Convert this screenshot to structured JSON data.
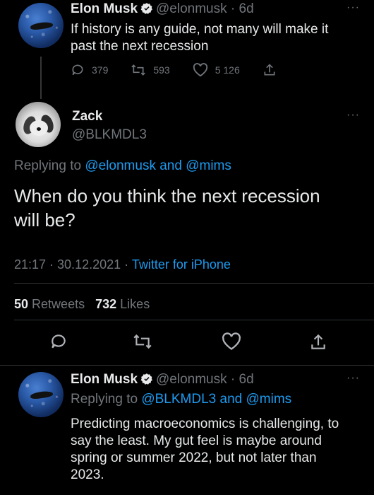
{
  "tweet1": {
    "name": "Elon Musk",
    "handle": "@elonmusk · 6d",
    "text_line1": "If history is any guide, not many will make it",
    "text_line2": "past the next recession",
    "replies": "379",
    "retweets": "593",
    "likes": "5 126",
    "more": "···"
  },
  "tweet2": {
    "name": "Zack",
    "handle": "@BLKMDL3",
    "replying_prefix": "Replying to",
    "replying_to": "@elonmusk and @mims",
    "text_line1": "When do you think the next recession",
    "text_line2": "will be?",
    "timestamp": "21:17 · 30.12.2021 ·",
    "source": "Twitter for iPhone",
    "retweets_count": "50",
    "retweets_label": "Retweets",
    "likes_count": "732",
    "likes_label": "Likes",
    "more": "···"
  },
  "tweet3": {
    "name": "Elon Musk",
    "handle": "@elonmusk · 6d",
    "replying_prefix": "Replying to",
    "replying_to": "@BLKMDL3 and @mims",
    "text_line1": "Predicting macroeconomics is challenging, to",
    "text_line2": "say the least. My gut feel is maybe around",
    "text_line3": "spring or summer 2022, but not later than",
    "text_line4": "2023.",
    "more": "···"
  },
  "colors": {
    "background": "#000000",
    "link": "#1d9bf0",
    "muted": "#71767b",
    "verified": "#1d9bf0"
  }
}
